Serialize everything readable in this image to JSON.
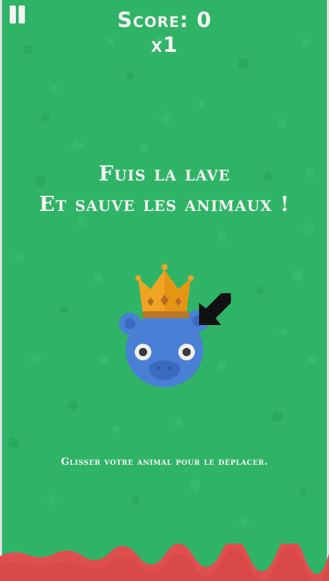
{
  "hud": {
    "score": "Score: 0",
    "multiplier": "x1"
  },
  "intro": {
    "line1": "Fuis la lave",
    "line2": "Et sauve les animaux !"
  },
  "hint": "Glisser votre animal pour le déplacer.",
  "icons": {
    "pause": "pause-icon",
    "crown": "crown-icon",
    "arrow": "pointer-arrow-icon",
    "animal": "hippo-character"
  },
  "colors": {
    "background": "#2fb467",
    "text": "#f3f4f1",
    "animal": "#4a7fd6",
    "crown": "#f0a424",
    "lava": "#e04f4f",
    "arrow": "#111111"
  }
}
